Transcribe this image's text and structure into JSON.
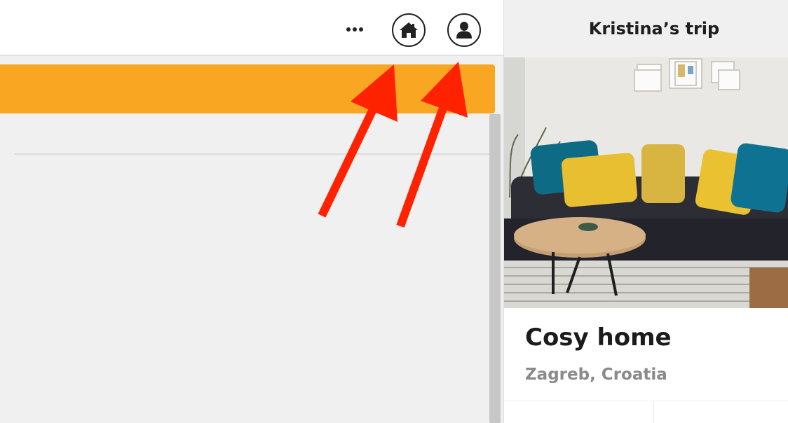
{
  "topbar": {
    "more_label": "More options",
    "home_label": "Home",
    "profile_label": "Profile"
  },
  "trip": {
    "title": "Kristina’s trip"
  },
  "listing": {
    "title": "Cosy home",
    "location": "Zagreb, Croatia",
    "photo": "living-room-photo"
  },
  "colors": {
    "accent_orange": "#F9A623",
    "annotation_red": "#FF2200",
    "text_dark": "#1B1B1B",
    "text_muted": "#8A8A8A"
  },
  "icons": {
    "more": "ellipsis-icon",
    "home": "home-icon",
    "profile": "user-icon"
  },
  "annotations": {
    "arrow_count": 2
  }
}
